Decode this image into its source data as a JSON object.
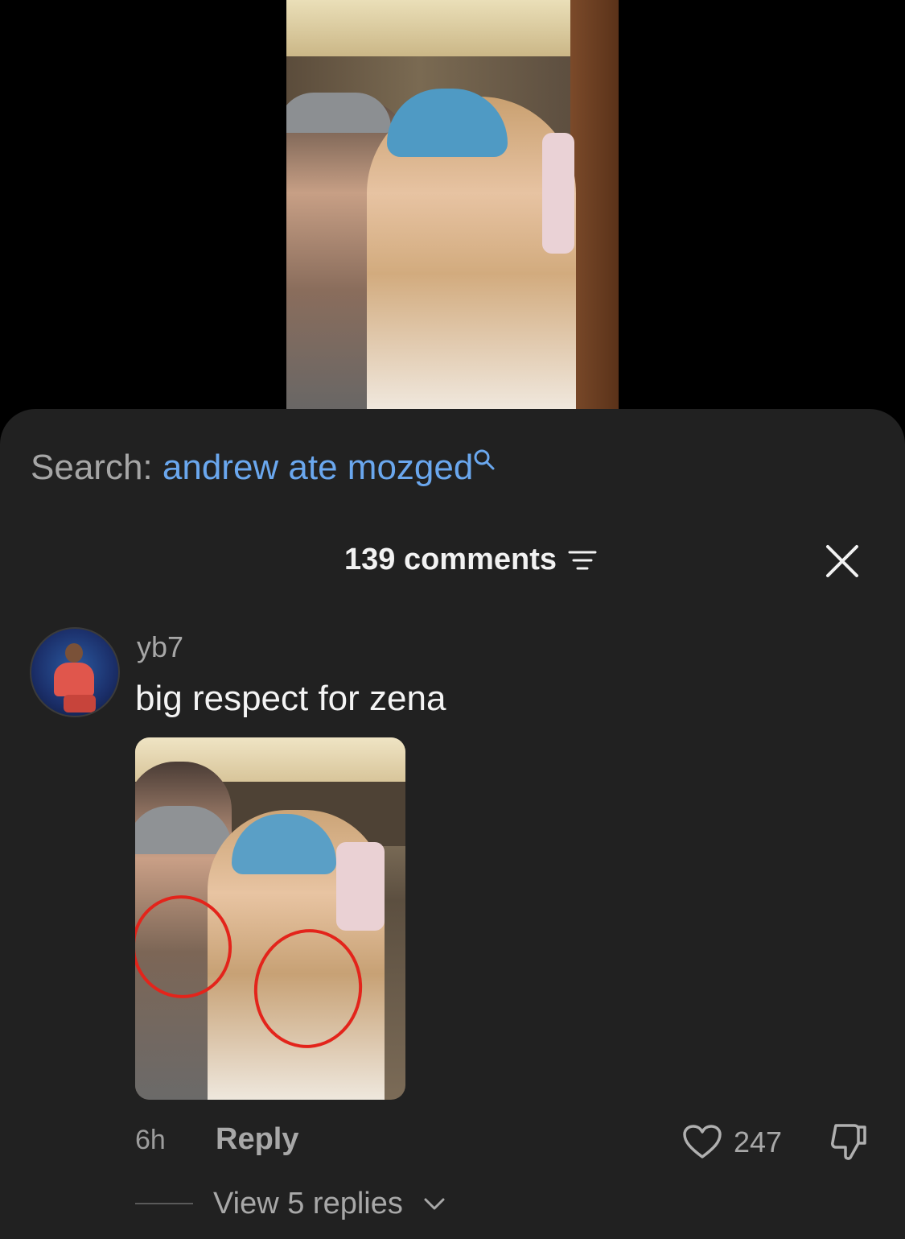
{
  "search": {
    "prefix": "Search:",
    "query": "andrew ate mozged"
  },
  "header": {
    "comments_count": "139 comments"
  },
  "comment": {
    "username": "yb7",
    "text": "big respect for zena",
    "time_ago": "6h",
    "reply_label": "Reply",
    "like_count": "247",
    "view_replies_label": "View 5 replies"
  },
  "colors": {
    "sheet_background": "#212121",
    "search_query": "#6aa7ee",
    "muted_text": "#a8a8a8",
    "annotation_circle": "#e3241b"
  },
  "icons": {
    "search": "search-icon",
    "filter": "filter-icon",
    "close": "close-icon",
    "like": "heart-icon",
    "dislike": "thumbs-down-icon",
    "expand": "chevron-down-icon"
  }
}
